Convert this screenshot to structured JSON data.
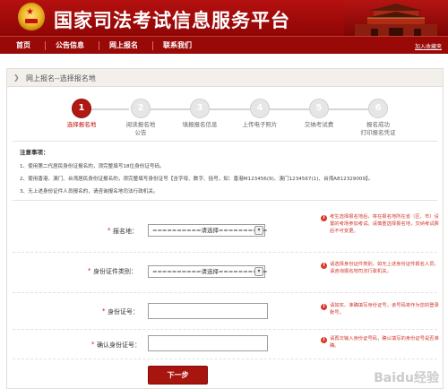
{
  "header": {
    "site_title": "国家司法考试信息服务平台"
  },
  "nav": {
    "items": [
      "首页",
      "公告信息",
      "网上报名",
      "联系我们"
    ],
    "favorite": "加入收藏夹"
  },
  "breadcrumb": "网上报名--选择报名地",
  "steps": [
    {
      "num": "1",
      "label": "选择报名地",
      "active": true
    },
    {
      "num": "2",
      "label": "阅读报名地\n公告"
    },
    {
      "num": "3",
      "label": "填报报名信息"
    },
    {
      "num": "4",
      "label": "上传电子照片"
    },
    {
      "num": "5",
      "label": "交纳考试费"
    },
    {
      "num": "6",
      "label": "报名成功\n打印报名凭证"
    }
  ],
  "notice": {
    "title": "注意事项：",
    "items": [
      "1、使用第二代居民身份证报名的，须完整填写18位身份证号码。",
      "2、使用香港、澳门、台湾居民身份证报名的，须完整填写身份证号【含字母、数字、括号，如：香港M123456(9)、澳门1234567(1)、台湾A812329009】。",
      "3、无上述身份证件人员报名的，请咨询报名地司法行政机关。"
    ]
  },
  "form": {
    "fields": [
      {
        "label": "报名地：",
        "value": "==========请选择=========="
      },
      {
        "label": "身份证件类别：",
        "value": "==========请选择=========="
      },
      {
        "label": "身份证号：",
        "value": ""
      },
      {
        "label": "确认身份证号：",
        "value": ""
      }
    ],
    "tips": [
      "考生选择报名地后，将在报名地所在省（区、市）设置的考场参加考试。请慎重选择报名地，交纳考试费后不可变更。",
      "请选择身份证件类别，如无上述身份证件报名人员，请咨询报名地司法行政机关。",
      "请如实、准确填写身份证号，该号码将作为您的登录账号。",
      "请再次输入身份证号码，确认填写的身份证号是否准确。"
    ],
    "submit": "下一步"
  },
  "watermark": "Baidu经验",
  "colors": {
    "brand_red": "#b01812",
    "nav_red": "#990907",
    "tip_red": "#d0342a"
  },
  "icons": [
    "national-emblem-icon",
    "tiananmen-gate-icon",
    "breadcrumb-arrow-icon",
    "info-tip-icon"
  ]
}
